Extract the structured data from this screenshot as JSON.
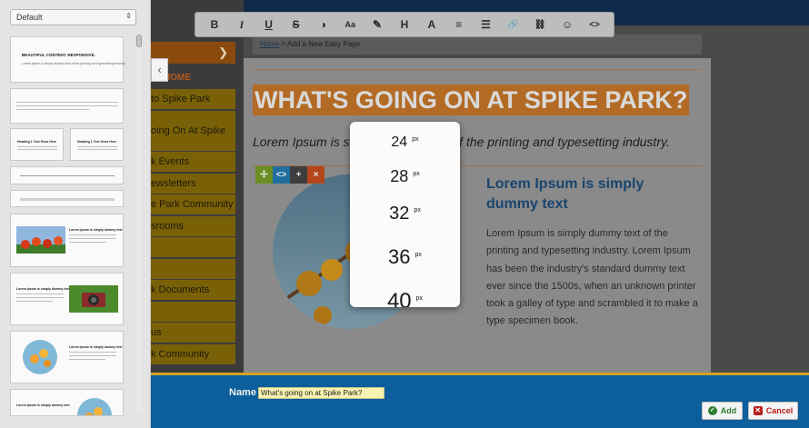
{
  "template_panel": {
    "select_value": "Default",
    "thumb1_title": "BEAUTIFUL CONTENT. RESPONSIVE.",
    "thumb1_sub": "Lorem ipsum is simply dummy text of the printing and typesetting industry.",
    "thumb3_left_title": "Heading 1 Text Goes Here",
    "thumb3_right_title": "Heading 1 Text Goes Here",
    "thumb_lorem_title": "Lorem Ipsum is simply dummy text"
  },
  "nav": {
    "home_label": "HOME",
    "items": [
      "to Spike Park",
      "oing On At Spike",
      "k Events",
      "ewsletters",
      "e Park Community",
      "srooms",
      "",
      "",
      "k Documents",
      "",
      "us",
      "k Community"
    ]
  },
  "toolbar": {
    "bold": "B",
    "italic": "I",
    "underline": "U",
    "strike": "S",
    "contrast": "◑",
    "font_size": "Aa",
    "eraser": "✎",
    "heading": "H",
    "font": "A",
    "align": "≡",
    "list": "☰",
    "link": "🔗",
    "unlink": "⛓",
    "emoji": "☺",
    "code": "<>"
  },
  "breadcrumb": {
    "home": "Home",
    "separator": " > ",
    "current": "Add a New Easy Page"
  },
  "page": {
    "headline": "WHAT'S GOING ON AT SPIKE PARK?",
    "tagline": "Lorem Ipsum is simply dummy text of the printing and typesetting industry.",
    "side_heading": "Lorem Ipsum is simply dummy text",
    "side_body": "Lorem Ipsum is simply dummy text of the printing and typesetting industry. Lorem Ipsum has been the industry's standard dummy text ever since the 1500s, when an unknown printer took a galley of type and scrambled it to make a type specimen book."
  },
  "block_toolbar": {
    "move": "✢",
    "code": "<>",
    "add": "+",
    "delete": "×"
  },
  "size_popup": {
    "unit": "px",
    "options": [
      "24",
      "28",
      "32",
      "36",
      "40"
    ]
  },
  "bottom": {
    "name_label": "Name",
    "name_value": "What's going on at Spike Park?",
    "add_label": "Add",
    "cancel_label": "Cancel"
  },
  "colors": {
    "accent_orange": "#b36a24",
    "bottom_bar_blue": "#0d5e9c",
    "heading_blue": "#19456e",
    "gold_border": "#d6a21e"
  }
}
